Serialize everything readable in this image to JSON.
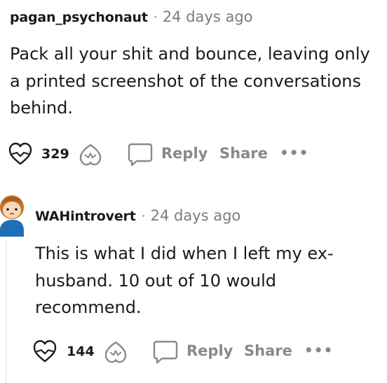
{
  "comments": [
    {
      "author": "pagan_psychonaut",
      "separator": "·",
      "time": "24 days ago",
      "body": [
        "Pack all your shit and bounce, leaving only",
        "a printed screenshot of the conversations",
        "behind."
      ],
      "score": "329",
      "reply_label": "Reply",
      "share_label": "Share",
      "more_label": "•••"
    },
    {
      "author": "WAHintrovert",
      "separator": "·",
      "time": "24 days ago",
      "body": [
        "This is what I did when I left my ex-",
        "husband. 10 out of 10 would",
        "recommend."
      ],
      "score": "144",
      "reply_label": "Reply",
      "share_label": "Share",
      "more_label": "•••"
    }
  ],
  "colors": {
    "text": "#1a1a1b",
    "muted": "#878a8c",
    "thread_line": "#edeff1",
    "avatar_hair": "#c2732a",
    "avatar_shirt": "#1e6fb8"
  },
  "icons": {
    "upvote": "heart-upvote-icon",
    "downvote": "heart-downvote-icon",
    "reply": "speech-bubble-icon",
    "avatar": "snoo-avatar-icon"
  }
}
